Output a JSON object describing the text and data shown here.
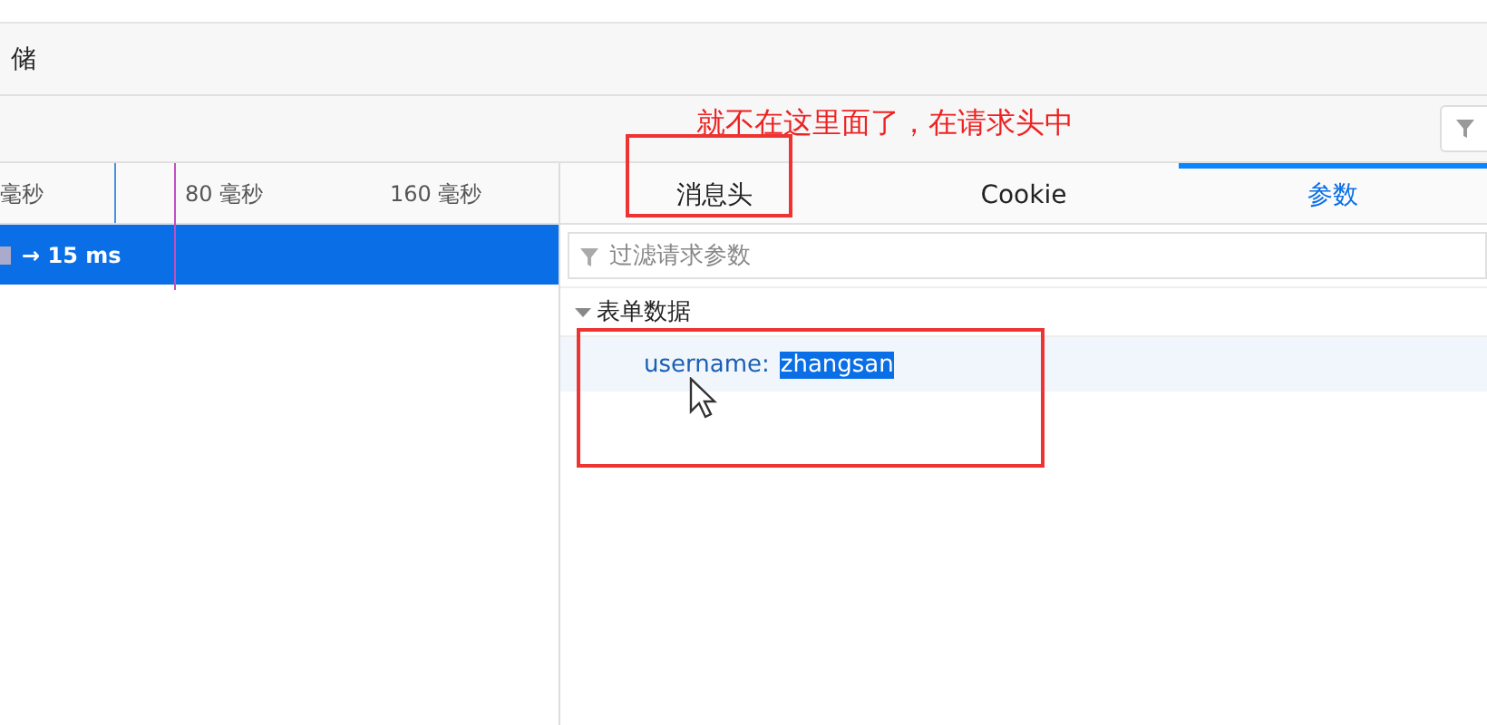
{
  "top_tab": {
    "label": "储"
  },
  "right_filter": {
    "kind": "filter"
  },
  "timeline": {
    "ticks": [
      "毫秒",
      "80 毫秒",
      "160 毫秒"
    ],
    "request": {
      "timing": "→ 15 ms",
      "selected": true
    }
  },
  "detail_tabs": [
    {
      "label": "消息头",
      "selected": false
    },
    {
      "label": "Cookie",
      "selected": false
    },
    {
      "label": "参数",
      "selected": true
    }
  ],
  "params_filter": {
    "placeholder": "过滤请求参数"
  },
  "section": {
    "title": "表单数据",
    "expanded": true,
    "params": [
      {
        "key": "username:",
        "value": "zhangsan",
        "value_selected": true
      }
    ]
  },
  "annotation": {
    "text": "就不在这里面了，在请求头中"
  }
}
